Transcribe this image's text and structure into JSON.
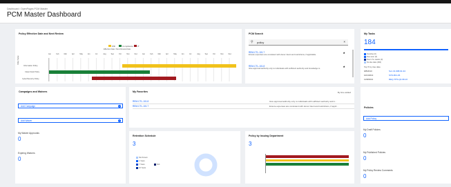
{
  "header": {
    "breadcrumb": "Dashboard / OpenPages PCM Master",
    "title": "PCM Master Dashboard"
  },
  "effective_chart": {
    "title": "Policy Effective Date and Next Review",
    "legend": [
      {
        "label": "Will",
        "color": "#f1c21b"
      },
      {
        "label": "Compliance",
        "color": "#198038"
      },
      {
        "label": "IT",
        "color": "#a2191f"
      }
    ],
    "axis_title": "Effective Date / Next Review Date",
    "months": [
      "Jan",
      "Feb",
      "Mar",
      "Apr",
      "May",
      "Jun",
      "Jul",
      "Aug",
      "Sep",
      "Oct",
      "Nov",
      "Dec",
      "Jan",
      "Feb",
      "Mar",
      "Apr",
      "May",
      "Jun",
      "Jul",
      "Aug",
      "Sep",
      "Oct",
      "Nov",
      "Dec"
    ],
    "rows": [
      "Information Policy",
      "Clean Desk Policy",
      "Cyber/Security Policy"
    ],
    "y_axis_label": "Policy Name"
  },
  "pcm_search": {
    "title": "PCM Search",
    "query": "policy",
    "results": [
      {
        "id": "REM-CTL-101.7",
        "desc": "Ensure expenses are consistent with donor intent and restrictions, if applicable."
      },
      {
        "id": "REM-CTL-101.8",
        "desc": "Give approval authority only to individuals with sufficient authority and knowledge to"
      }
    ]
  },
  "my_tasks": {
    "title": "My Tasks",
    "count": "184",
    "legend": [
      "Overdue (0)",
      "Due soon (0)",
      "Due in 5+ weeks (0)",
      "No due date (184)"
    ],
    "subtitle": "Top 5 by due date",
    "rows": [
      {
        "date": "9/8/2013",
        "id": "Svc-31-998-91-94"
      },
      {
        "date": "10/1/2013",
        "id": "SVS-801-06"
      },
      {
        "date": "11/8/2013",
        "id": "REQ-TPS-Q4-98-16"
      }
    ]
  },
  "campaigns": {
    "title": "Campaigns and Waivers",
    "add_campaign": "Add Campaign",
    "add_waiver": "Add Waiver",
    "approvals_label": "My Waiver Approvals",
    "approvals_count": "0",
    "expiring_label": "Expiring Waivers",
    "expiring_count": "0"
  },
  "favorites": {
    "title": "My Favorites",
    "sort_label": "By time added",
    "items": [
      {
        "id": "REM-CTL-101.8",
        "desc": "Give approval authority only to individuals with sufficient authority and k..."
      },
      {
        "id": "REM-CTL-101.7",
        "desc": "Ensure expenses are consistent with donor intent and restrictions, if appli..."
      }
    ]
  },
  "retention": {
    "title": "Retention Schedule",
    "count": "3",
    "legend": [
      "Not Known",
      "1 Years",
      "7 Years",
      "10 Years",
      "N/A"
    ]
  },
  "policy_by_dept": {
    "title": "Policy by Issuing Department",
    "count": "3",
    "categories": [
      "HR",
      "Compliance",
      "Finance",
      "Legal"
    ]
  },
  "policies": {
    "title": "Policies",
    "add_policy": "Add Policy",
    "draft_label": "My Draft Policies",
    "draft_count": "0",
    "published_label": "My Published Policies",
    "published_count": "0",
    "comments_label": "My Policy Review Comments",
    "comments_count": "0"
  },
  "chart_data": [
    {
      "type": "bar",
      "title": "Policy by Issuing Department",
      "categories": [
        "HR",
        "Compliance",
        "Finance",
        "Legal"
      ],
      "series": [
        {
          "values": [
            1,
            1,
            1,
            0
          ]
        }
      ]
    },
    {
      "type": "pie",
      "title": "Retention Schedule",
      "categories": [
        "Not Known",
        "1 Years",
        "7 Years",
        "10 Years",
        "N/A"
      ],
      "values": [
        3,
        0,
        0,
        0,
        0
      ]
    }
  ]
}
